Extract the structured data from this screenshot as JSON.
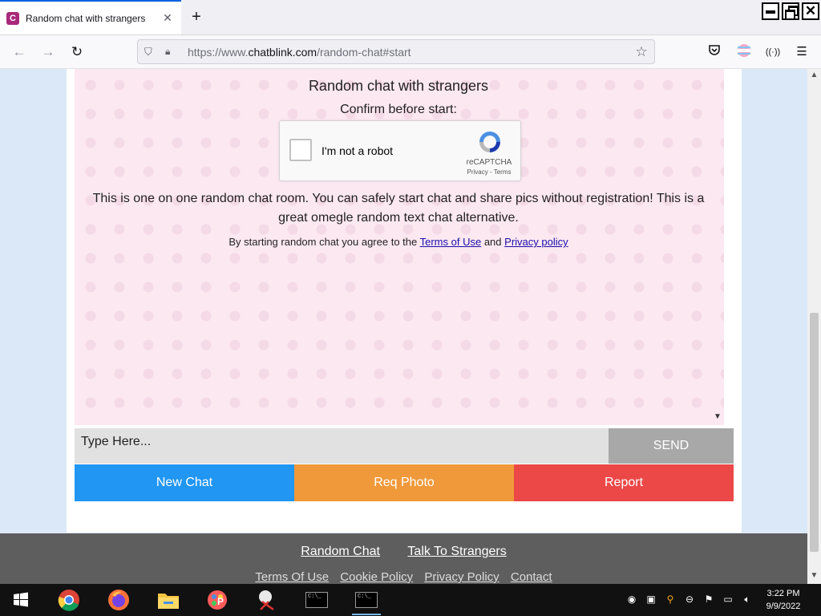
{
  "browser": {
    "tab_title": "Random chat with strangers",
    "tab_favicon_letter": "C",
    "url_prefix": "https://www.",
    "url_domain": "chatblink.com",
    "url_path": "/random-chat#start"
  },
  "chat": {
    "heading": "Random chat with strangers",
    "confirm_text": "Confirm before start:",
    "recaptcha": {
      "label": "I'm not a robot",
      "brand": "reCAPTCHA",
      "links": "Privacy - Terms"
    },
    "description": "This is one on one random chat room. You can safely start chat and share pics without registration! This is a great omegle random text chat alternative.",
    "agree_prefix": "By starting random chat you agree to the",
    "terms_link": "Terms of Use",
    "agree_and": "and",
    "privacy_link": "Privacy policy"
  },
  "input": {
    "placeholder": "Type Here...",
    "send_label": "SEND"
  },
  "actions": {
    "new_chat": "New Chat",
    "req_photo": "Req Photo",
    "report": "Report"
  },
  "footer": {
    "primary_links": [
      "Random Chat",
      "Talk To Strangers"
    ],
    "secondary_links": [
      "Terms Of Use",
      "Cookie Policy",
      "Privacy Policy",
      "Contact"
    ]
  },
  "taskbar": {
    "time": "3:22 PM",
    "date": "9/9/2022",
    "apps": [
      "start-icon",
      "chrome-icon",
      "firefox-icon",
      "file-explorer-icon",
      "paint-icon",
      "snipping-tool-icon",
      "terminal-icon",
      "terminal-icon"
    ]
  },
  "colors": {
    "new_chat": "#2196f3",
    "req_photo": "#f0993a",
    "report": "#ec4848",
    "send": "#a8a8a8",
    "chat_bg": "#fce8f1"
  }
}
